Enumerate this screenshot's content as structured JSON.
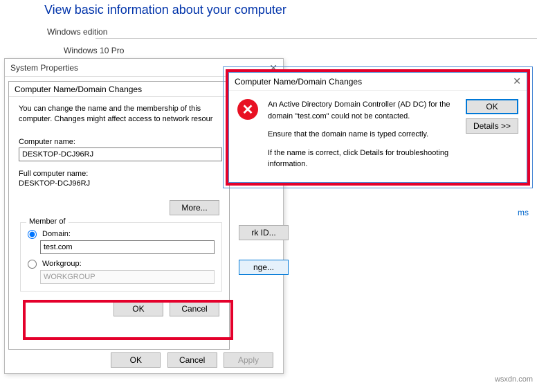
{
  "sysinfo": {
    "title": "View basic information about your computer",
    "edition_heading": "Windows edition",
    "edition_value": "Windows 10 Pro"
  },
  "links": {
    "network_id": "rk ID...",
    "change": "nge...",
    "right": "ms"
  },
  "sysprops": {
    "title": "System Properties",
    "ok": "OK",
    "cancel": "Cancel",
    "apply": "Apply"
  },
  "changes": {
    "title": "Computer Name/Domain Changes",
    "desc": "You can change the name and the membership of this computer. Changes might affect access to network resour",
    "computer_name_label": "Computer name:",
    "computer_name": "DESKTOP-DCJ96RJ",
    "full_name_label": "Full computer name:",
    "full_name": "DESKTOP-DCJ96RJ",
    "more": "More...",
    "member_of": "Member of",
    "domain_label": "Domain:",
    "domain_value": "test.com",
    "workgroup_label": "Workgroup:",
    "workgroup_value": "WORKGROUP",
    "ok": "OK",
    "cancel": "Cancel"
  },
  "error": {
    "title": "Computer Name/Domain Changes",
    "line1": "An Active Directory Domain Controller (AD DC) for the domain \"test.com\" could not be contacted.",
    "line2": "Ensure that the domain name is typed correctly.",
    "line3": "If the name is correct, click Details for troubleshooting information.",
    "ok": "OK",
    "details": "Details >>"
  },
  "watermark": "wsxdn.com"
}
